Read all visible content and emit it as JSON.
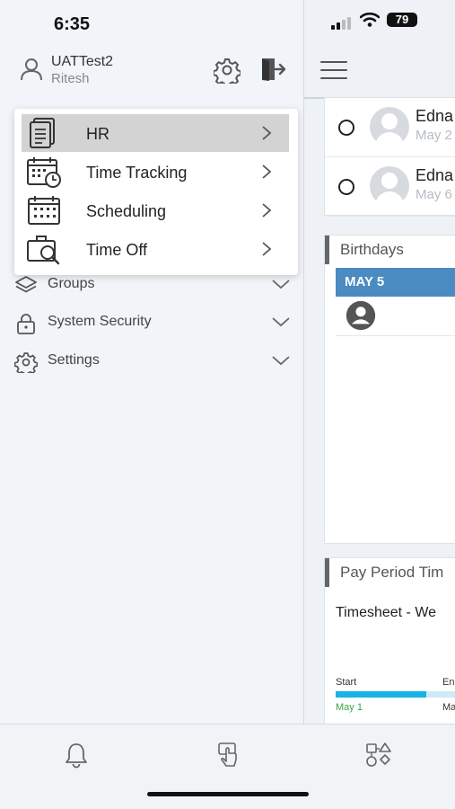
{
  "status_bar": {
    "time": "6:35",
    "battery": "79"
  },
  "user": {
    "name": "UATTest2",
    "subtitle": "Ritesh"
  },
  "popup_menu": {
    "items": [
      {
        "label": "HR",
        "icon": "document-stack-icon",
        "active": true
      },
      {
        "label": "Time Tracking",
        "icon": "calendar-clock-icon"
      },
      {
        "label": "Scheduling",
        "icon": "calendar-grid-icon"
      },
      {
        "label": "Time Off",
        "icon": "suitcase-search-icon"
      }
    ]
  },
  "nav": {
    "items": [
      {
        "label": "Groups",
        "icon": "layers-icon"
      },
      {
        "label": "System Security",
        "icon": "lock-icon"
      },
      {
        "label": "Settings",
        "icon": "gear-icon"
      }
    ]
  },
  "tasks": {
    "rows": [
      {
        "name": "Edna",
        "date": "May 2"
      },
      {
        "name": "Edna",
        "date": "May 6"
      }
    ]
  },
  "birthdays": {
    "title": "Birthdays",
    "date_header": "MAY 5"
  },
  "pay_period": {
    "title": "Pay Period Tim",
    "timesheet_label": "Timesheet - We",
    "start_label": "Start",
    "end_label": "En",
    "start_date": "May 1",
    "end_date": "May",
    "progress": 0.63
  },
  "tabbar": {
    "tabs": [
      {
        "icon": "bell-icon"
      },
      {
        "icon": "touch-hand-icon"
      },
      {
        "icon": "shapes-icon"
      }
    ]
  },
  "colors": {
    "accent": "#4a8bc2",
    "progress": "#17b3e6",
    "active_item": "#d3d3d3"
  }
}
